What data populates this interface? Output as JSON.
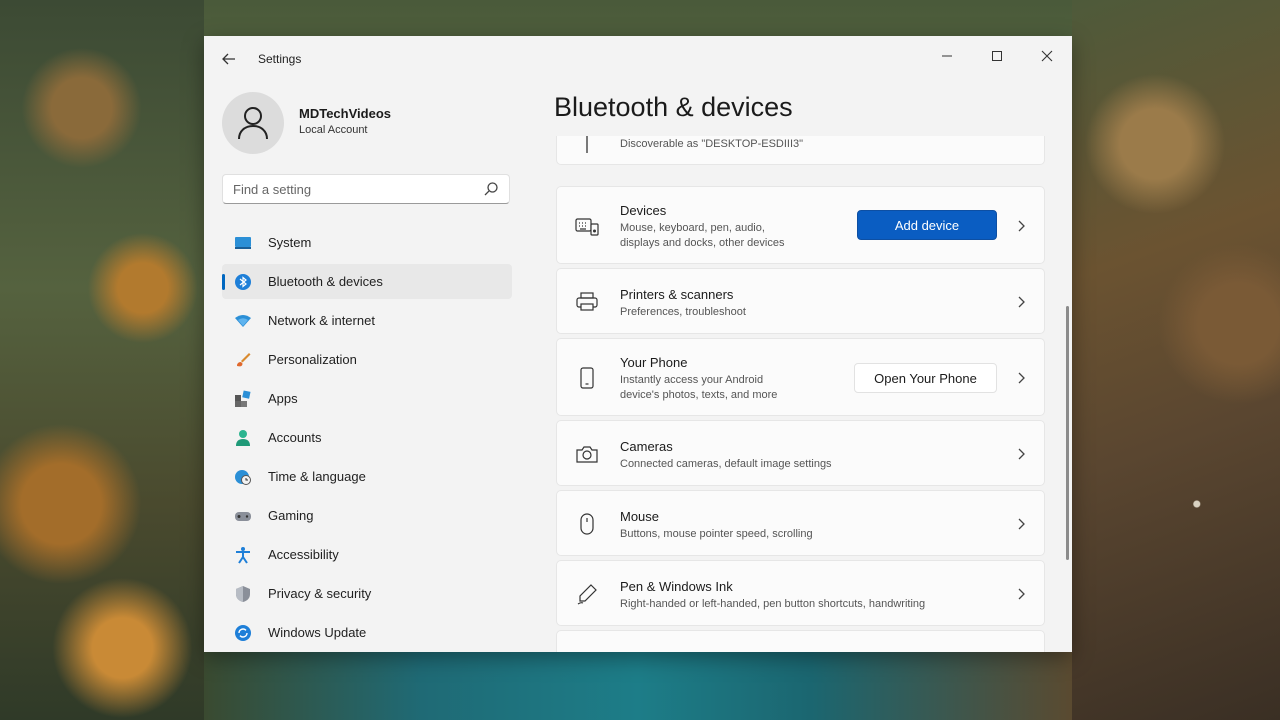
{
  "window": {
    "title": "Settings",
    "page_title": "Bluetooth & devices"
  },
  "profile": {
    "name": "MDTechVideos",
    "account_type": "Local Account"
  },
  "search": {
    "placeholder": "Find a setting"
  },
  "sidebar": {
    "items": [
      {
        "label": "System",
        "icon": "monitor-icon",
        "active": false
      },
      {
        "label": "Bluetooth & devices",
        "icon": "bluetooth-icon",
        "active": true
      },
      {
        "label": "Network & internet",
        "icon": "wifi-icon",
        "active": false
      },
      {
        "label": "Personalization",
        "icon": "brush-icon",
        "active": false
      },
      {
        "label": "Apps",
        "icon": "apps-icon",
        "active": false
      },
      {
        "label": "Accounts",
        "icon": "person-icon",
        "active": false
      },
      {
        "label": "Time & language",
        "icon": "globe-clock-icon",
        "active": false
      },
      {
        "label": "Gaming",
        "icon": "gamepad-icon",
        "active": false
      },
      {
        "label": "Accessibility",
        "icon": "accessibility-icon",
        "active": false
      },
      {
        "label": "Privacy & security",
        "icon": "shield-icon",
        "active": false
      },
      {
        "label": "Windows Update",
        "icon": "refresh-icon",
        "active": false
      }
    ]
  },
  "cards": {
    "bluetooth": {
      "subtitle": "Discoverable as \"DESKTOP-ESDIII3\""
    },
    "devices": {
      "title": "Devices",
      "subtitle1": "Mouse, keyboard, pen, audio,",
      "subtitle2": "displays and docks, other devices",
      "button": "Add device"
    },
    "printers": {
      "title": "Printers & scanners",
      "subtitle": "Preferences, troubleshoot"
    },
    "phone": {
      "title": "Your Phone",
      "subtitle1": "Instantly access your Android",
      "subtitle2": "device's photos, texts, and more",
      "button": "Open Your Phone"
    },
    "cameras": {
      "title": "Cameras",
      "subtitle": "Connected cameras, default image settings"
    },
    "mouse": {
      "title": "Mouse",
      "subtitle": "Buttons, mouse pointer speed, scrolling"
    },
    "pen": {
      "title": "Pen & Windows Ink",
      "subtitle": "Right-handed or left-handed, pen button shortcuts, handwriting"
    }
  },
  "colors": {
    "accent": "#0067c0",
    "button_primary": "#0a5dc2",
    "window_bg": "#f3f3f3",
    "card_bg": "#fbfbfb"
  }
}
